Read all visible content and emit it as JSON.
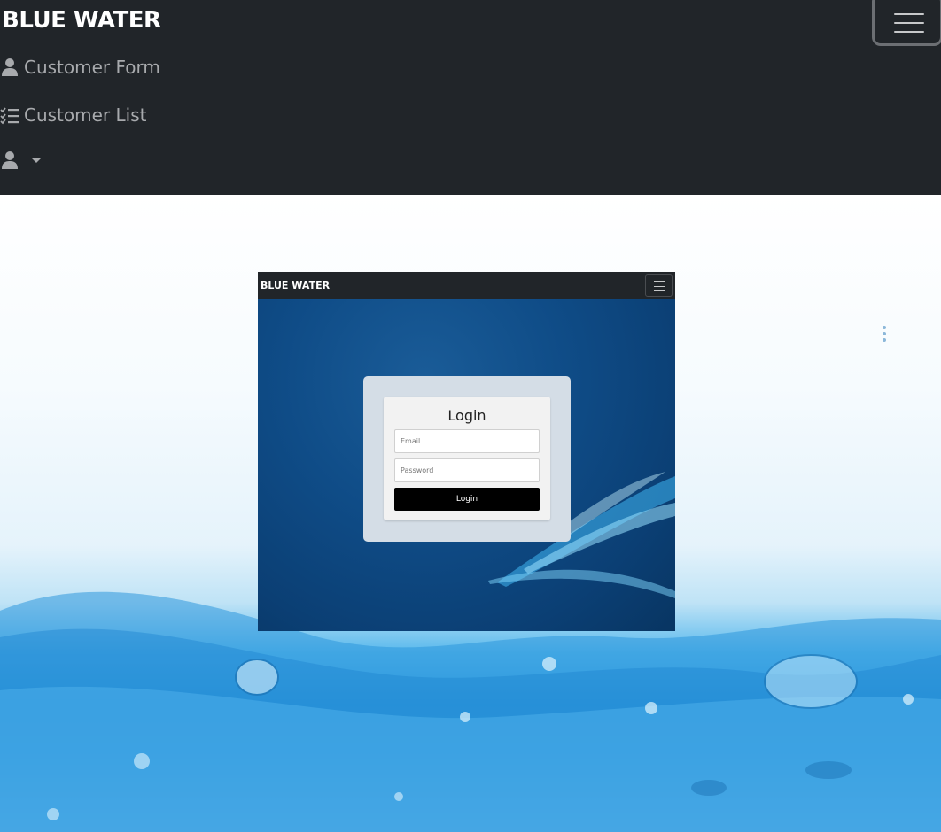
{
  "navbar": {
    "brand": "BLUE WATER",
    "links": [
      {
        "label": "Customer Form",
        "icon": "user-icon"
      },
      {
        "label": "Customer List",
        "icon": "checklist-icon"
      },
      {
        "label": "",
        "icon": "user-icon"
      }
    ]
  },
  "embedded_screenshot": {
    "brand": "BLUE WATER",
    "login": {
      "title": "Login",
      "email_placeholder": "Email",
      "password_placeholder": "Password",
      "button_label": "Login"
    }
  },
  "colors": {
    "navbar_bg": "#212529",
    "nav_link": "#a8aaad",
    "login_button": "#000000",
    "screenshot_bg": "#0f4c87"
  }
}
